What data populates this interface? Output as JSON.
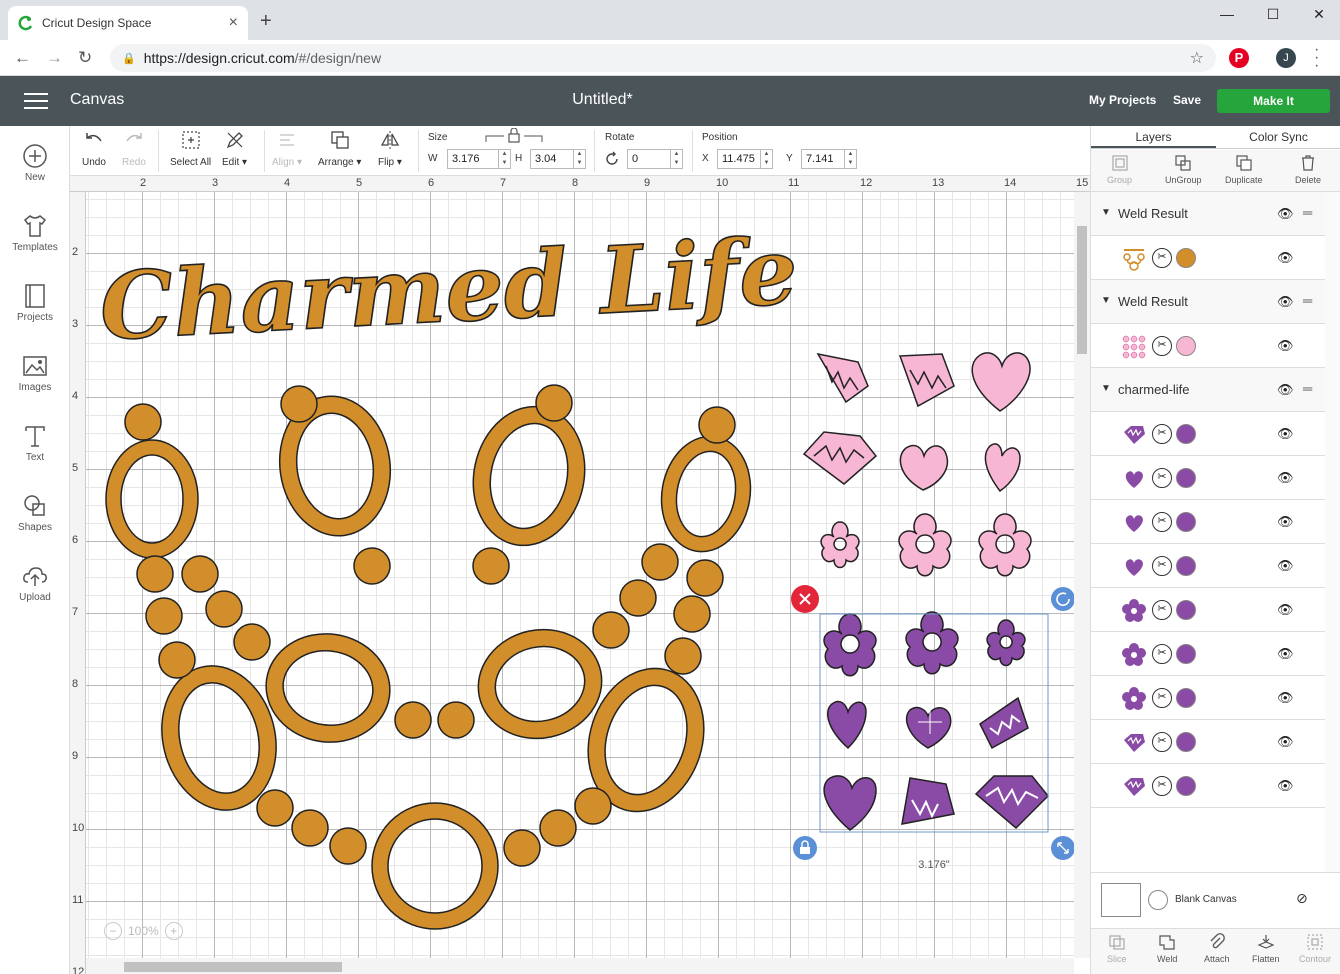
{
  "browser": {
    "tab_title": "Cricut Design Space",
    "url_host": "https://design.cricut.com",
    "url_path": "/#/design/new",
    "avatar_letter": "J"
  },
  "header": {
    "section": "Canvas",
    "doc_title": "Untitled*",
    "my_projects": "My Projects",
    "save": "Save",
    "make_it": "Make It"
  },
  "sidebar": {
    "items": [
      {
        "label": "New",
        "icon": "plus-circle-icon"
      },
      {
        "label": "Templates",
        "icon": "tshirt-icon"
      },
      {
        "label": "Projects",
        "icon": "book-icon"
      },
      {
        "label": "Images",
        "icon": "image-icon"
      },
      {
        "label": "Text",
        "icon": "text-icon"
      },
      {
        "label": "Shapes",
        "icon": "shapes-icon"
      },
      {
        "label": "Upload",
        "icon": "upload-cloud-icon"
      }
    ]
  },
  "toolbar": {
    "undo": "Undo",
    "redo": "Redo",
    "select_all": "Select All",
    "edit": "Edit",
    "align": "Align",
    "arrange": "Arrange",
    "flip": "Flip",
    "size_label": "Size",
    "w_label": "W",
    "w_value": "3.176",
    "h_label": "H",
    "h_value": "3.04",
    "rotate_label": "Rotate",
    "rotate_value": "0",
    "position_label": "Position",
    "x_label": "X",
    "x_value": "11.475",
    "y_label": "Y",
    "y_value": "7.141"
  },
  "canvas": {
    "ruler_top": [
      "2",
      "3",
      "4",
      "5",
      "6",
      "7",
      "8",
      "9",
      "10",
      "11",
      "12",
      "13",
      "14",
      "15"
    ],
    "ruler_left": [
      "2",
      "3",
      "4",
      "5",
      "6",
      "7",
      "8",
      "9",
      "10",
      "11",
      "12"
    ],
    "title_art": "Charmed Life",
    "selection_width": "3.176\"",
    "zoom": "100%",
    "colors": {
      "gold": "#d18e2b",
      "pink": "#f7b6d3",
      "purple": "#8a4ba6",
      "delete_red": "#e3263a",
      "handle_blue": "#5b8fd6"
    }
  },
  "panel": {
    "tabs": [
      "Layers",
      "Color Sync"
    ],
    "actions": [
      {
        "label": "Group",
        "disabled": true
      },
      {
        "label": "UnGroup",
        "disabled": false
      },
      {
        "label": "Duplicate",
        "disabled": false
      },
      {
        "label": "Delete",
        "disabled": false
      }
    ],
    "groups": [
      {
        "name": "Weld Result",
        "rows": [
          {
            "shape": "necklace",
            "color": "#d18e2b"
          }
        ]
      },
      {
        "name": "Weld Result",
        "rows": [
          {
            "shape": "charms-grid",
            "color": "#f7b6d3"
          }
        ]
      },
      {
        "name": "charmed-life",
        "rows": [
          {
            "shape": "gem",
            "color": "#8a4ba6"
          },
          {
            "shape": "heart",
            "color": "#8a4ba6"
          },
          {
            "shape": "heart",
            "color": "#8a4ba6"
          },
          {
            "shape": "heart",
            "color": "#8a4ba6"
          },
          {
            "shape": "flower",
            "color": "#8a4ba6"
          },
          {
            "shape": "flower",
            "color": "#8a4ba6"
          },
          {
            "shape": "flower",
            "color": "#8a4ba6"
          },
          {
            "shape": "gem",
            "color": "#8a4ba6"
          },
          {
            "shape": "gem",
            "color": "#8a4ba6"
          }
        ]
      }
    ],
    "blank_canvas": "Blank Canvas",
    "bottom_actions": [
      {
        "label": "Slice",
        "disabled": true
      },
      {
        "label": "Weld",
        "disabled": false
      },
      {
        "label": "Attach",
        "disabled": false
      },
      {
        "label": "Flatten",
        "disabled": false
      },
      {
        "label": "Contour",
        "disabled": true
      }
    ]
  }
}
